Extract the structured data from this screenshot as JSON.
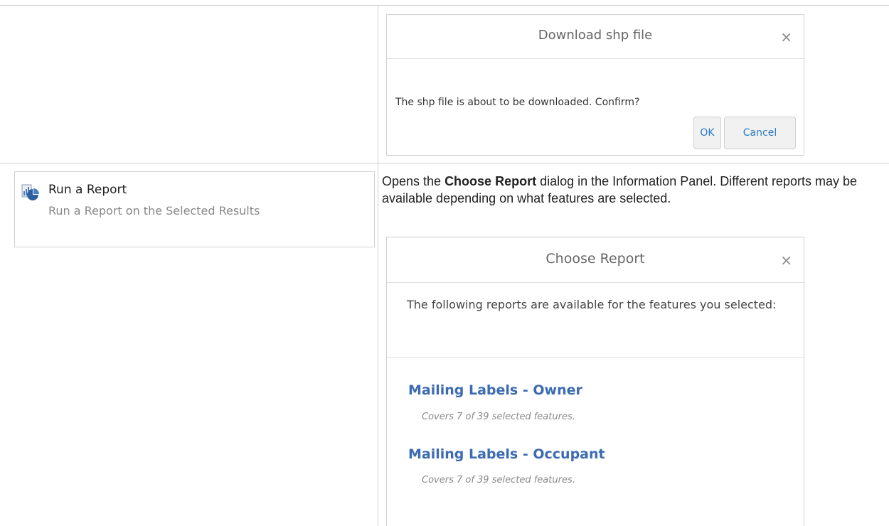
{
  "download_dialog": {
    "title": "Download shp file",
    "close_glyph": "×",
    "message": "The shp file is about to be downloaded. Confirm?",
    "ok_label": "OK",
    "cancel_label": "Cancel"
  },
  "report_tool": {
    "icon": "report-chart-icon",
    "title": "Run a Report",
    "subtitle": "Run a Report on the Selected Results"
  },
  "description": {
    "part1": "Opens the ",
    "bold": "Choose Report",
    "part2": " dialog in the Information Panel. Different reports may be available depending on what features are selected."
  },
  "report_dialog": {
    "title": "Choose Report",
    "close_glyph": "×",
    "intro": "The following reports are available for the features you selected:",
    "reports": [
      {
        "name": "Mailing Labels - Owner",
        "note": "Covers 7 of 39 selected features."
      },
      {
        "name": "Mailing Labels - Occupant",
        "note": "Covers 7 of 39 selected features."
      }
    ]
  },
  "colors": {
    "link": "#3b6bb3",
    "button_text": "#2d7bbf",
    "border": "#cfcfcf"
  }
}
